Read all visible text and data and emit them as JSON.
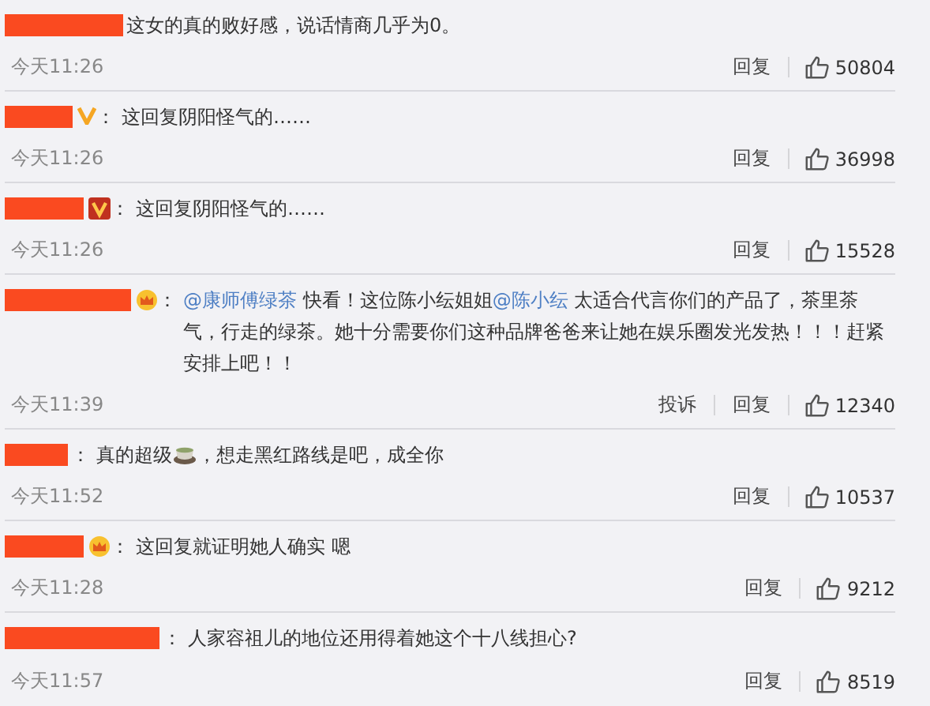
{
  "comments": [
    {
      "parts": [
        {
          "kind": "text",
          "text": "这女的真的败好感，说话情商几乎为0。"
        }
      ],
      "time": "今天11:26",
      "actions": [
        "回复"
      ],
      "likes": "50804"
    },
    {
      "badge": {
        "kind": "v-plain"
      },
      "separator": "：",
      "parts": [
        {
          "kind": "text",
          "text": "这回复阴阳怪气的……"
        }
      ],
      "time": "今天11:26",
      "actions": [
        "回复"
      ],
      "likes": "36998"
    },
    {
      "badge": {
        "kind": "v-boxed"
      },
      "separator": "：",
      "parts": [
        {
          "kind": "text",
          "text": "这回复阴阳怪气的……"
        }
      ],
      "time": "今天11:26",
      "actions": [
        "回复"
      ],
      "likes": "15528"
    },
    {
      "badge": {
        "kind": "crown"
      },
      "separator": "：",
      "parts": [
        {
          "kind": "mention",
          "text": "@康师傅绿茶"
        },
        {
          "kind": "text",
          "text": " 快看！这位陈小纭姐姐"
        },
        {
          "kind": "mention",
          "text": "@陈小纭"
        },
        {
          "kind": "text",
          "text": " 太适合代言你们的产品了，茶里茶气，行走的绿茶。她十分需要你们这种品牌爸爸来让她在娱乐圈发光发热！！！赶紧安排上吧！！"
        }
      ],
      "time": "今天11:39",
      "actions": [
        "投诉",
        "回复"
      ],
      "likes": "12340"
    },
    {
      "separator": "：",
      "parts": [
        {
          "kind": "text",
          "text": "真的超级"
        },
        {
          "kind": "emoji"
        },
        {
          "kind": "text",
          "text": "，想走黑红路线是吧，成全你"
        }
      ],
      "time": "今天11:52",
      "actions": [
        "回复"
      ],
      "likes": "10537"
    },
    {
      "badge": {
        "kind": "crown"
      },
      "separator": "：",
      "parts": [
        {
          "kind": "text",
          "text": "这回复就证明她人确实 嗯"
        }
      ],
      "time": "今天11:28",
      "actions": [
        "回复"
      ],
      "likes": "9212"
    },
    {
      "separator": "：",
      "parts": [
        {
          "kind": "text",
          "text": "人家容祖儿的地位还用得着她这个十八线担心?"
        }
      ],
      "time": "今天11:57",
      "actions": [
        "回复"
      ],
      "likes": "8519"
    }
  ]
}
